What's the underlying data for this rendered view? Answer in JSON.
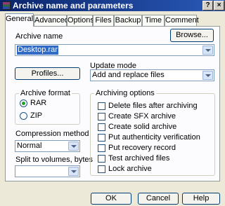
{
  "window": {
    "title": "Archive name and parameters",
    "help_label": "?",
    "close_label": "×"
  },
  "tabs": [
    "General",
    "Advanced",
    "Options",
    "Files",
    "Backup",
    "Time",
    "Comment"
  ],
  "active_tab": "General",
  "general": {
    "archive_name_label": "Archive name",
    "archive_name_value": "Desktop.rar",
    "browse_label": "Browse...",
    "profiles_label": "Profiles...",
    "update_mode_label": "Update mode",
    "update_mode_value": "Add and replace files",
    "archive_format": {
      "title": "Archive format",
      "options": [
        "RAR",
        "ZIP"
      ],
      "selected": "RAR"
    },
    "compression_label": "Compression method",
    "compression_value": "Normal",
    "split_label": "Split to volumes, bytes",
    "split_value": "",
    "archiving_options": {
      "title": "Archiving options",
      "items": [
        {
          "label": "Delete files after archiving",
          "checked": false
        },
        {
          "label": "Create SFX archive",
          "checked": false
        },
        {
          "label": "Create solid archive",
          "checked": false
        },
        {
          "label": "Put authenticity verification",
          "checked": false
        },
        {
          "label": "Put recovery record",
          "checked": false
        },
        {
          "label": "Test archived files",
          "checked": false
        },
        {
          "label": "Lock archive",
          "checked": false
        }
      ]
    }
  },
  "buttons": {
    "ok": "OK",
    "cancel": "Cancel",
    "help": "Help"
  },
  "colors": {
    "titlebar_start": "#0a246a",
    "titlebar_end": "#2a5ab8",
    "dialog_bg": "#ece9d8",
    "selection": "#316ac5",
    "radio_dot": "#21a121"
  }
}
